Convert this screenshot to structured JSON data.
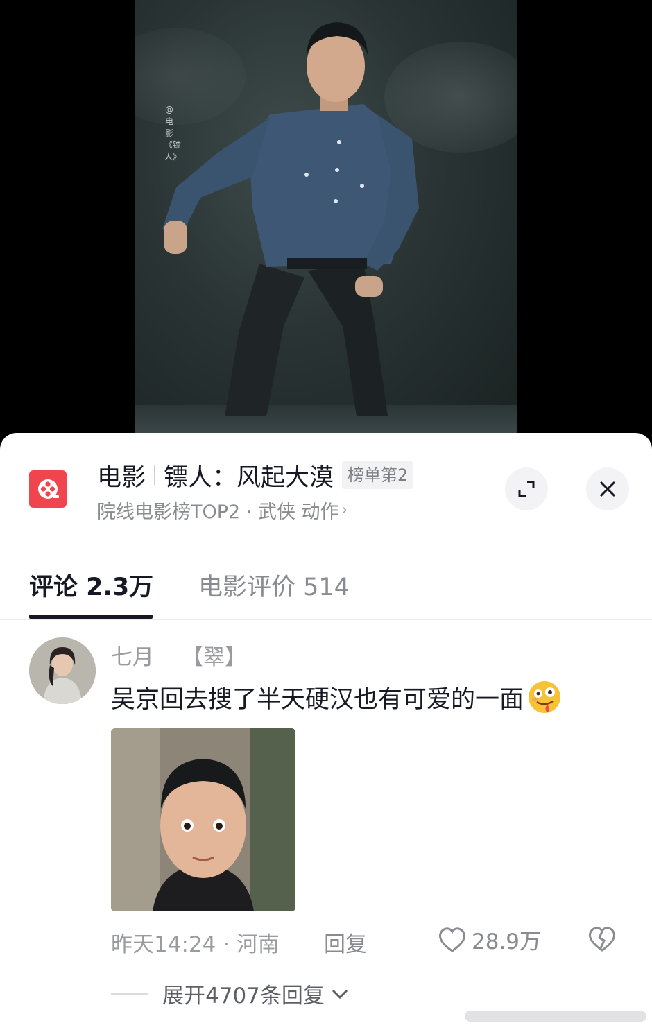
{
  "video": {
    "watermark": "@电影《镖人》"
  },
  "movie": {
    "category": "电影",
    "name": "镖人：风起大漠",
    "rank_badge": "榜单第2",
    "subtitle": "院线电影榜TOP2 · 武侠 动作",
    "subtitle_chevron": "›"
  },
  "tabs": {
    "comments": "评论 2.3万",
    "reviews": "电影评价 514"
  },
  "comment": {
    "username": "七月",
    "tag": "【翠】",
    "text": "吴京回去搜了半天硬汉也有可爱的一面",
    "time_location": "昨天14:24 · 河南",
    "reply_label": "回复",
    "like_count": "28.9万",
    "expand_replies": "展开4707条回复"
  },
  "colors": {
    "logo_red": "#f0454e",
    "text_primary": "#161823",
    "text_secondary": "#8a8b91"
  },
  "icons": [
    "movie-app-icon",
    "expand-icon",
    "close-icon",
    "heart-icon",
    "broken-heart-icon",
    "chevron-down-icon",
    "emoji-drool-icon"
  ]
}
